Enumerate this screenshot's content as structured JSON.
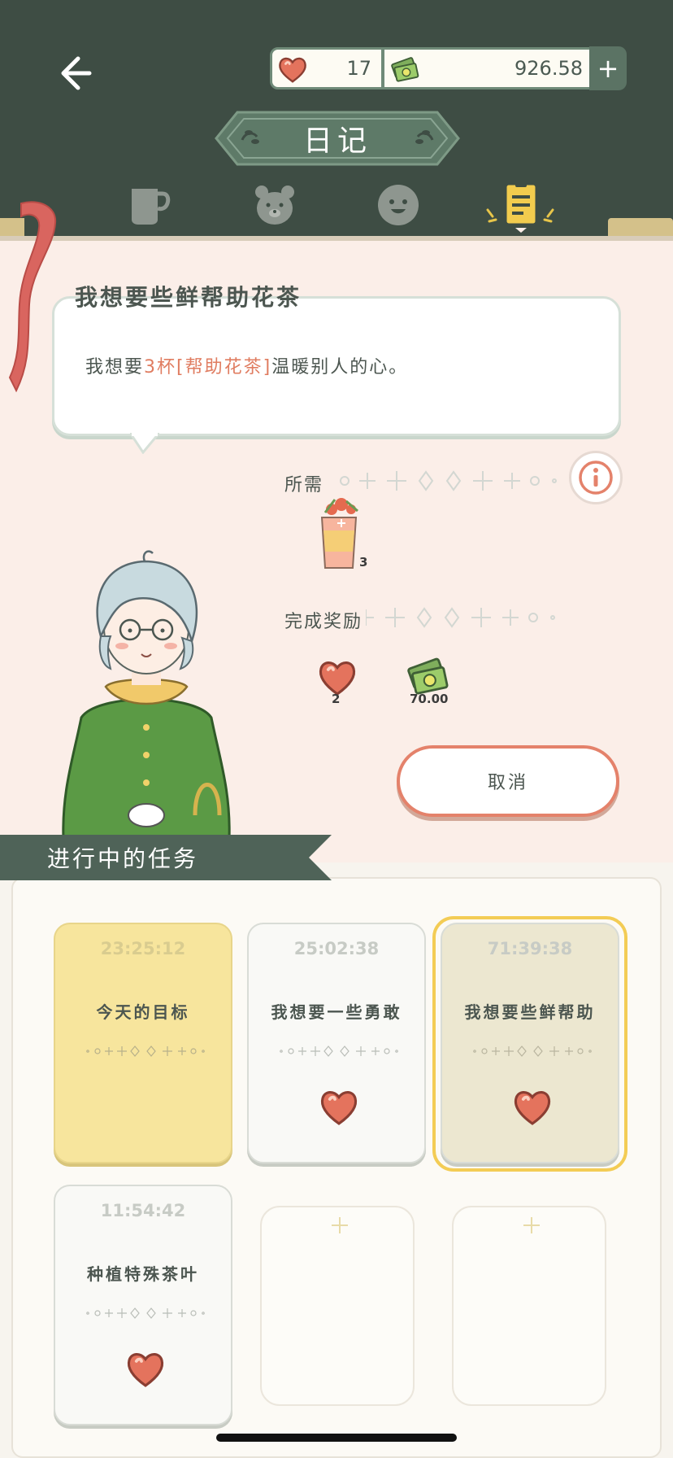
{
  "header": {
    "hearts": "17",
    "money": "926.58",
    "title": "日记",
    "tabs": [
      "cup",
      "bear",
      "face",
      "diary"
    ],
    "active_tab": "diary"
  },
  "quest": {
    "title": "我想要些鲜帮助花茶",
    "text_before": "我想要",
    "text_highlight": "3杯[帮助花茶]",
    "text_after": "温暖别人的心。",
    "required_label": "所需",
    "required_item": {
      "name": "帮助花茶",
      "qty": "3"
    },
    "reward_label": "完成奖励",
    "rewards": [
      {
        "icon": "heart-icon",
        "amount": "2"
      },
      {
        "icon": "money-icon",
        "amount": "70.00"
      }
    ],
    "cancel_label": "取消"
  },
  "tasks": {
    "section_title": "进行中的任务",
    "cards": [
      {
        "timer": "23:25:12",
        "title": "今天的目标",
        "style": "yellow"
      },
      {
        "timer": "25:02:38",
        "title": "我想要一些勇敢",
        "style": "white"
      },
      {
        "timer": "71:39:38",
        "title": "我想要些鲜帮助",
        "style": "selected"
      },
      {
        "timer": "11:54:42",
        "title": "种植特殊茶叶",
        "style": "white"
      }
    ]
  },
  "colors": {
    "header_bg": "#3e4d44",
    "accent_green": "#5b7364",
    "highlight": "#e07d61",
    "panel_bg": "#fbeee8",
    "card_yellow": "#f7e59d",
    "selected_border": "#f3cc55"
  }
}
